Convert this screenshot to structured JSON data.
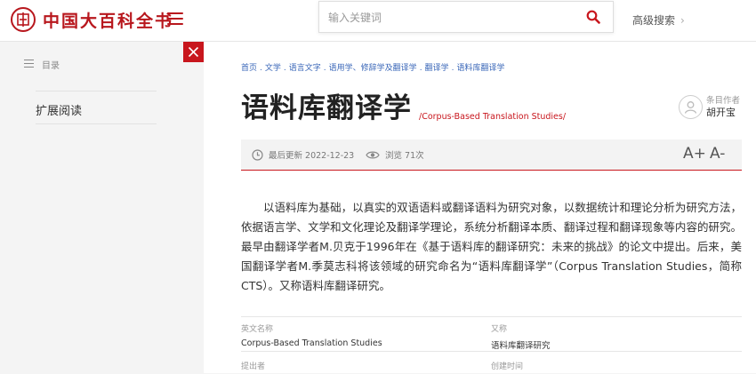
{
  "header": {
    "logo_text": "中国大百科全书",
    "search_placeholder": "输入关键词",
    "advanced_search": "高级搜索"
  },
  "sidebar": {
    "toc_label": "目录",
    "items": [
      {
        "label": "扩展阅读"
      }
    ]
  },
  "article": {
    "breadcrumb": [
      "首页",
      "文学",
      "语言文字",
      "语用学、修辞学及翻译学",
      "翻译学",
      "语料库翻译学"
    ],
    "title": "语料库翻译学",
    "title_en": "/Corpus-Based Translation Studies/",
    "author_label": "条目作者",
    "author_name": "胡开宝",
    "last_updated": "最后更新 2022-12-23",
    "views": "浏览 71次",
    "font_increase": "A+",
    "font_decrease": "A-",
    "body": "以语料库为基础，以真实的双语语料或翻译语料为研究对象，以数据统计和理论分析为研究方法，依据语言学、文学和文化理论及翻译学理论，系统分析翻译本质、翻译过程和翻译现象等内容的研究。最早由翻译学者M.贝克于1996年在《基于语料库的翻译研究：未来的挑战》的论文中提出。后来，美国翻译学者M.季莫志科将该领域的研究命名为“语料库翻译学”（Corpus Translation Studies，简称CTS）。又称语料库翻译研究。",
    "info": [
      {
        "label": "英文名称",
        "value": "Corpus-Based Translation Studies"
      },
      {
        "label": "又称",
        "value": "语料库翻译研究"
      },
      {
        "label": "提出者",
        "value": ""
      },
      {
        "label": "创建时间",
        "value": ""
      }
    ]
  },
  "colors": {
    "brand_red": "#c8161d",
    "link_blue": "#3a67b8"
  }
}
